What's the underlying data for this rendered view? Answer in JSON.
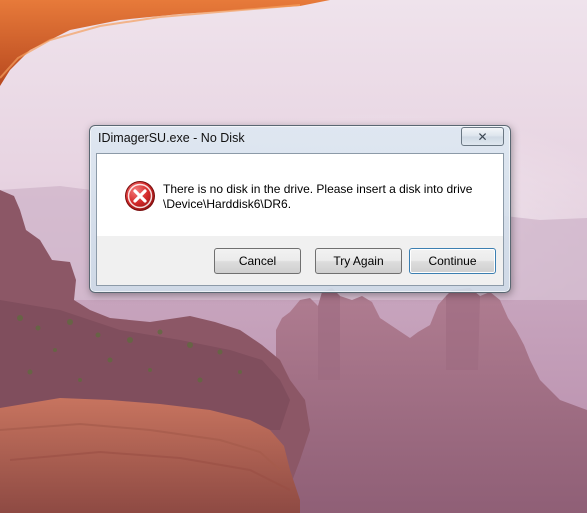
{
  "dialog": {
    "title": "IDimagerSU.exe - No Disk",
    "close_symbol": "✕",
    "icon": "error-icon",
    "message_line1": "There is no disk in the drive. Please insert a disk into drive",
    "message_line2": "\\Device\\Harddisk6\\DR6.",
    "buttons": {
      "cancel": "Cancel",
      "try_again": "Try Again",
      "continue": "Continue"
    }
  },
  "colors": {
    "error_red": "#d42a2a",
    "focus_border": "#3c7fb1"
  }
}
